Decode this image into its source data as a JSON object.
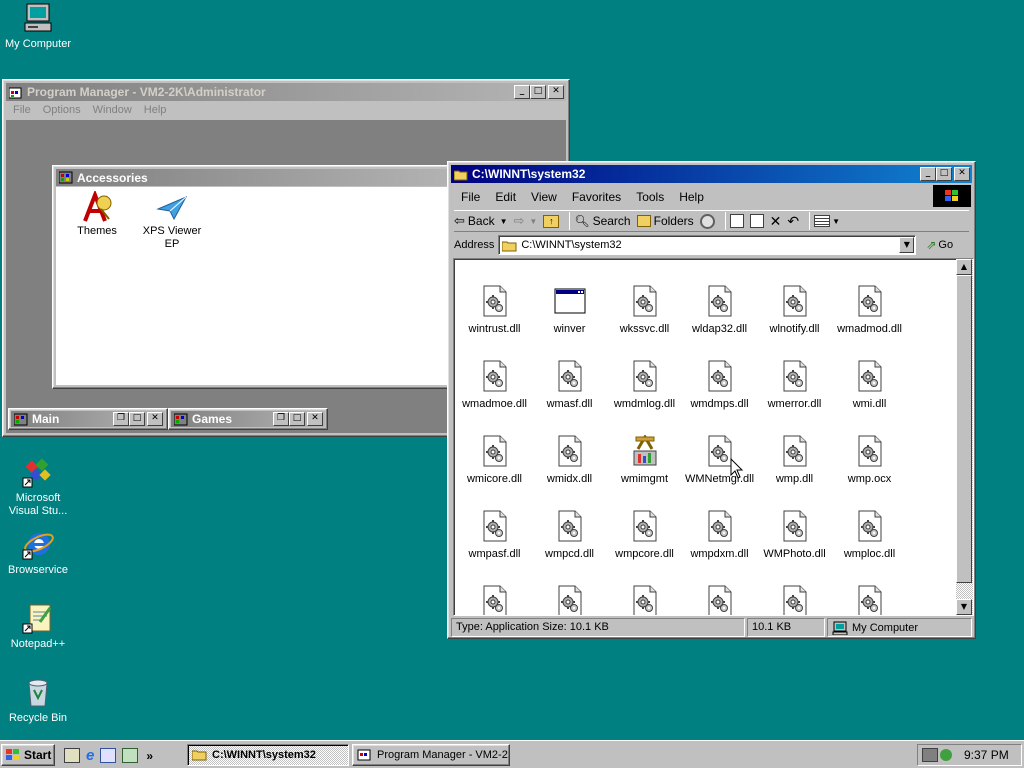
{
  "desktop": {
    "icons": [
      {
        "label": "My Computer"
      },
      {
        "label": "Microsoft Visual Stu..."
      },
      {
        "label": "Browservice"
      },
      {
        "label": "Notepad++"
      },
      {
        "label": "Recycle Bin"
      }
    ]
  },
  "program_manager": {
    "title": "Program Manager - VM2-2K\\Administrator",
    "menu": [
      "File",
      "Options",
      "Window",
      "Help"
    ],
    "accessories": {
      "title": "Accessories",
      "items": [
        {
          "label": "Themes"
        },
        {
          "label": "XPS Viewer EP"
        }
      ]
    },
    "minimized": [
      {
        "label": "Main"
      },
      {
        "label": "Games"
      }
    ]
  },
  "explorer": {
    "title": "C:\\WINNT\\system32",
    "menu": [
      "File",
      "Edit",
      "View",
      "Favorites",
      "Tools",
      "Help"
    ],
    "toolbar": {
      "back": "Back",
      "search": "Search",
      "folders": "Folders"
    },
    "address": {
      "label": "Address",
      "value": "C:\\WINNT\\system32",
      "go": "Go"
    },
    "files": [
      {
        "name": "wintrust.dll",
        "icon": "dll"
      },
      {
        "name": "winver",
        "icon": "app"
      },
      {
        "name": "wkssvc.dll",
        "icon": "dll"
      },
      {
        "name": "wldap32.dll",
        "icon": "dll"
      },
      {
        "name": "wlnotify.dll",
        "icon": "dll"
      },
      {
        "name": "wmadmod.dll",
        "icon": "dll"
      },
      {
        "name": "wmadmoe.dll",
        "icon": "dll"
      },
      {
        "name": "wmasf.dll",
        "icon": "dll"
      },
      {
        "name": "wmdmlog.dll",
        "icon": "dll"
      },
      {
        "name": "wmdmps.dll",
        "icon": "dll"
      },
      {
        "name": "wmerror.dll",
        "icon": "dll"
      },
      {
        "name": "wmi.dll",
        "icon": "dll"
      },
      {
        "name": "wmicore.dll",
        "icon": "dll"
      },
      {
        "name": "wmidx.dll",
        "icon": "dll"
      },
      {
        "name": "wmimgmt",
        "icon": "mgmt"
      },
      {
        "name": "WMNetmgr.dll",
        "icon": "dll"
      },
      {
        "name": "wmp.dll",
        "icon": "dll"
      },
      {
        "name": "wmp.ocx",
        "icon": "dll"
      },
      {
        "name": "wmpasf.dll",
        "icon": "dll"
      },
      {
        "name": "wmpcd.dll",
        "icon": "dll"
      },
      {
        "name": "wmpcore.dll",
        "icon": "dll"
      },
      {
        "name": "wmpdxm.dll",
        "icon": "dll"
      },
      {
        "name": "WMPhoto.dll",
        "icon": "dll"
      },
      {
        "name": "wmploc.dll",
        "icon": "dll"
      },
      {
        "name": "",
        "icon": "dll"
      },
      {
        "name": "",
        "icon": "dll"
      },
      {
        "name": "",
        "icon": "dll"
      },
      {
        "name": "",
        "icon": "dll"
      },
      {
        "name": "",
        "icon": "dll"
      },
      {
        "name": "",
        "icon": "dll"
      }
    ],
    "status": {
      "type_size": "Type: Application Size: 10.1 KB",
      "size": "10.1 KB",
      "zone": "My Computer"
    }
  },
  "taskbar": {
    "start": "Start",
    "tasks": [
      {
        "label": "C:\\WINNT\\system32"
      },
      {
        "label": "Program Manager - VM2-2..."
      }
    ],
    "clock": "9:37 PM"
  }
}
